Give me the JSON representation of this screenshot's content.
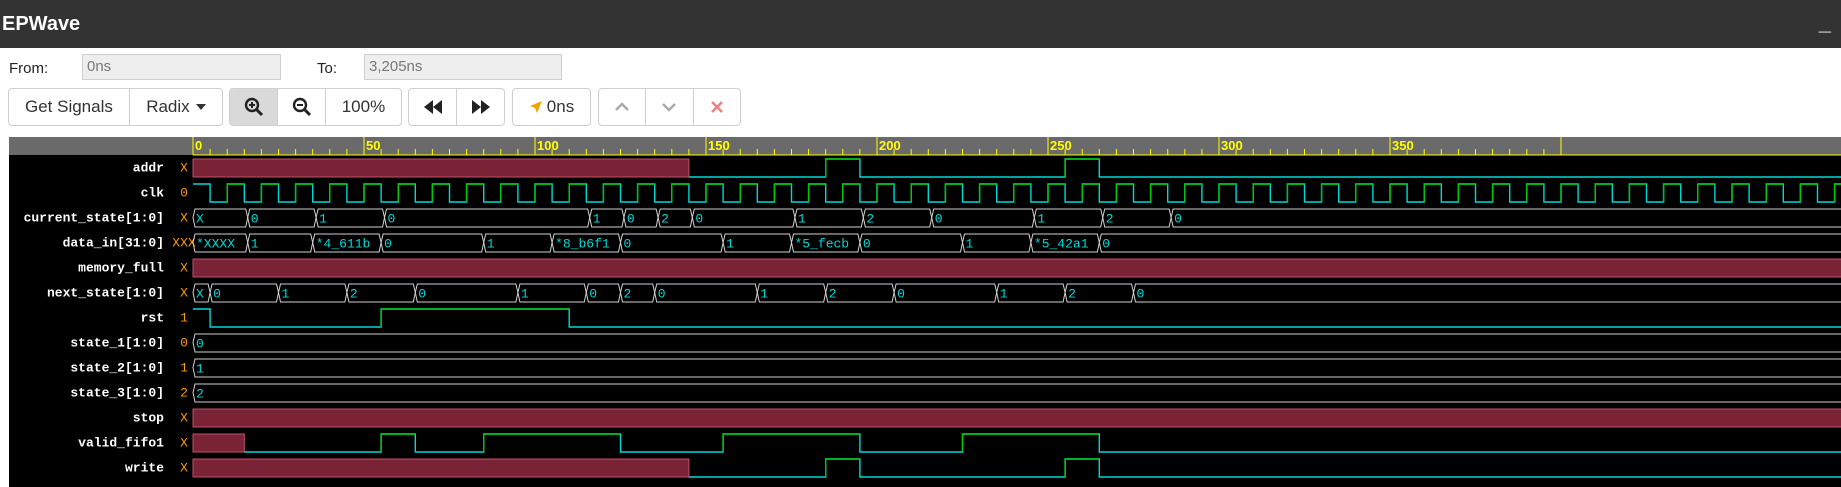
{
  "window": {
    "title": "EPWave",
    "minimize_label": "_"
  },
  "range": {
    "from_label": "From:",
    "from_value": "0ns",
    "to_label": "To:",
    "to_value": "3,205ns"
  },
  "toolbar": {
    "get_signals": "Get Signals",
    "radix": "Radix",
    "zoom_in_icon": "zoom-in-icon",
    "zoom_out_icon": "zoom-out-icon",
    "zoom_level": "100%",
    "prev_icon": "rewind-icon",
    "next_icon": "fast-forward-icon",
    "cursor_time": "0ns",
    "cursor_icon": "arrow-pointer-icon",
    "up_icon": "chevron-up-icon",
    "down_icon": "chevron-down-icon",
    "remove_icon": "close-icon"
  },
  "colors": {
    "titlebar": "#333333",
    "wave_bg": "#000000",
    "ruler_bg": "#6a6a6a",
    "ruler_text": "#ffff00",
    "signal_green": "#00c800",
    "signal_cyan": "#00d7d7",
    "unknown_fill": "#7b2336",
    "value_orange": "#ff9900"
  },
  "ruler": {
    "ticks": [
      "0",
      "50",
      "100",
      "150",
      "200",
      "250",
      "300",
      "350"
    ]
  },
  "signals": [
    {
      "name": "addr",
      "value": "X"
    },
    {
      "name": "clk",
      "value": "0"
    },
    {
      "name": "current_state[1:0]",
      "value": "X"
    },
    {
      "name": "data_in[31:0]",
      "value": "XXX"
    },
    {
      "name": "memory_full",
      "value": "X"
    },
    {
      "name": "next_state[1:0]",
      "value": "X"
    },
    {
      "name": "rst",
      "value": "1"
    },
    {
      "name": "state_1[1:0]",
      "value": "0"
    },
    {
      "name": "state_2[1:0]",
      "value": "1"
    },
    {
      "name": "state_3[1:0]",
      "value": "2"
    },
    {
      "name": "stop",
      "value": "X"
    },
    {
      "name": "valid_fifo1",
      "value": "X"
    },
    {
      "name": "write",
      "value": "X"
    }
  ],
  "bus_values": {
    "current_state": [
      {
        "t": 0,
        "v": "X"
      },
      {
        "t": 16,
        "v": "0"
      },
      {
        "t": 36,
        "v": "1"
      },
      {
        "t": 56,
        "v": "0"
      },
      {
        "t": 116,
        "v": "1"
      },
      {
        "t": 126,
        "v": "0"
      },
      {
        "t": 136,
        "v": "2"
      },
      {
        "t": 146,
        "v": "0"
      },
      {
        "t": 176,
        "v": "1"
      },
      {
        "t": 196,
        "v": "2"
      },
      {
        "t": 216,
        "v": "0"
      },
      {
        "t": 246,
        "v": "1"
      },
      {
        "t": 266,
        "v": "2"
      },
      {
        "t": 286,
        "v": "0"
      }
    ],
    "data_in": [
      {
        "t": 0,
        "v": "*XXXX"
      },
      {
        "t": 16,
        "v": "1"
      },
      {
        "t": 35,
        "v": "*4_611b"
      },
      {
        "t": 55,
        "v": "0"
      },
      {
        "t": 85,
        "v": "1"
      },
      {
        "t": 105,
        "v": "*8_b6f1"
      },
      {
        "t": 125,
        "v": "0"
      },
      {
        "t": 155,
        "v": "1"
      },
      {
        "t": 175,
        "v": "*5_fecb"
      },
      {
        "t": 195,
        "v": "0"
      },
      {
        "t": 225,
        "v": "1"
      },
      {
        "t": 245,
        "v": "*5_42a1"
      },
      {
        "t": 265,
        "v": "0"
      }
    ],
    "next_state": [
      {
        "t": 0,
        "v": "X"
      },
      {
        "t": 5,
        "v": "0"
      },
      {
        "t": 25,
        "v": "1"
      },
      {
        "t": 45,
        "v": "2"
      },
      {
        "t": 65,
        "v": "0"
      },
      {
        "t": 95,
        "v": "1"
      },
      {
        "t": 115,
        "v": "0"
      },
      {
        "t": 125,
        "v": "2"
      },
      {
        "t": 135,
        "v": "0"
      },
      {
        "t": 165,
        "v": "1"
      },
      {
        "t": 185,
        "v": "2"
      },
      {
        "t": 205,
        "v": "0"
      },
      {
        "t": 235,
        "v": "1"
      },
      {
        "t": 255,
        "v": "2"
      },
      {
        "t": 275,
        "v": "0"
      }
    ],
    "state_1": [
      {
        "t": 0,
        "v": "0"
      }
    ],
    "state_2": [
      {
        "t": 0,
        "v": "1"
      }
    ],
    "state_3": [
      {
        "t": 0,
        "v": "2"
      }
    ]
  }
}
